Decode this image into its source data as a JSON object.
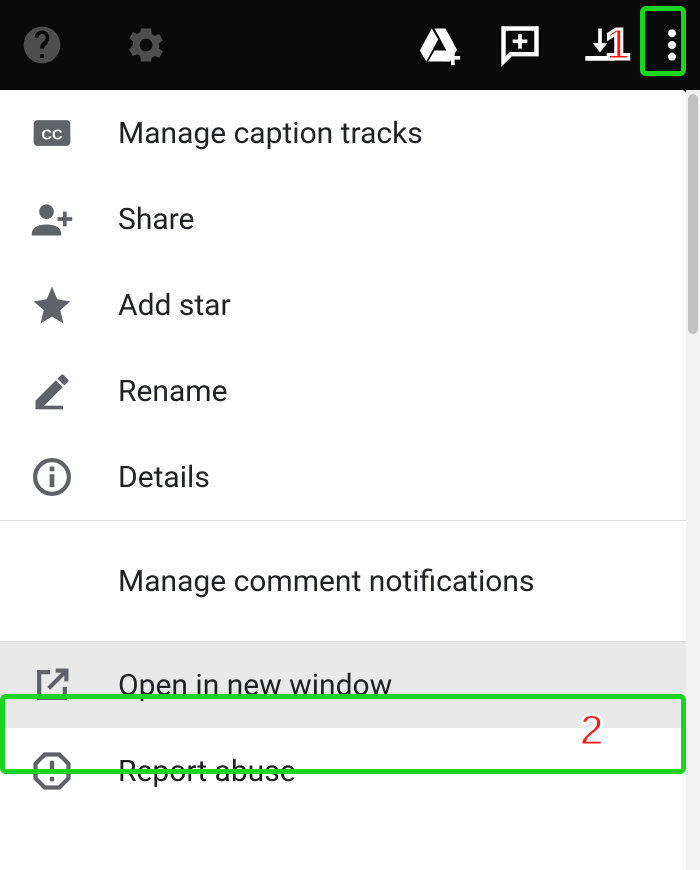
{
  "toolbar": {
    "icons": {
      "help": "help-icon",
      "settings": "gear-icon",
      "drive": "drive-add-icon",
      "comment": "add-comment-icon",
      "download": "download-icon",
      "more": "more-vert-icon"
    }
  },
  "menu": {
    "items": [
      {
        "id": "manage-captions",
        "icon": "cc-icon",
        "label": "Manage caption tracks"
      },
      {
        "id": "share",
        "icon": "person-add-icon",
        "label": "Share"
      },
      {
        "id": "add-star",
        "icon": "star-icon",
        "label": "Add star"
      },
      {
        "id": "rename",
        "icon": "edit-icon",
        "label": "Rename"
      },
      {
        "id": "details",
        "icon": "info-icon",
        "label": "Details"
      },
      {
        "id": "manage-comments",
        "icon": "",
        "label": "Manage comment notifications"
      },
      {
        "id": "open-new-window",
        "icon": "open-in-new-icon",
        "label": "Open in new window"
      },
      {
        "id": "report-abuse",
        "icon": "report-icon",
        "label": "Report abuse"
      }
    ]
  },
  "annotations": {
    "step1": "1",
    "step2": "2"
  }
}
